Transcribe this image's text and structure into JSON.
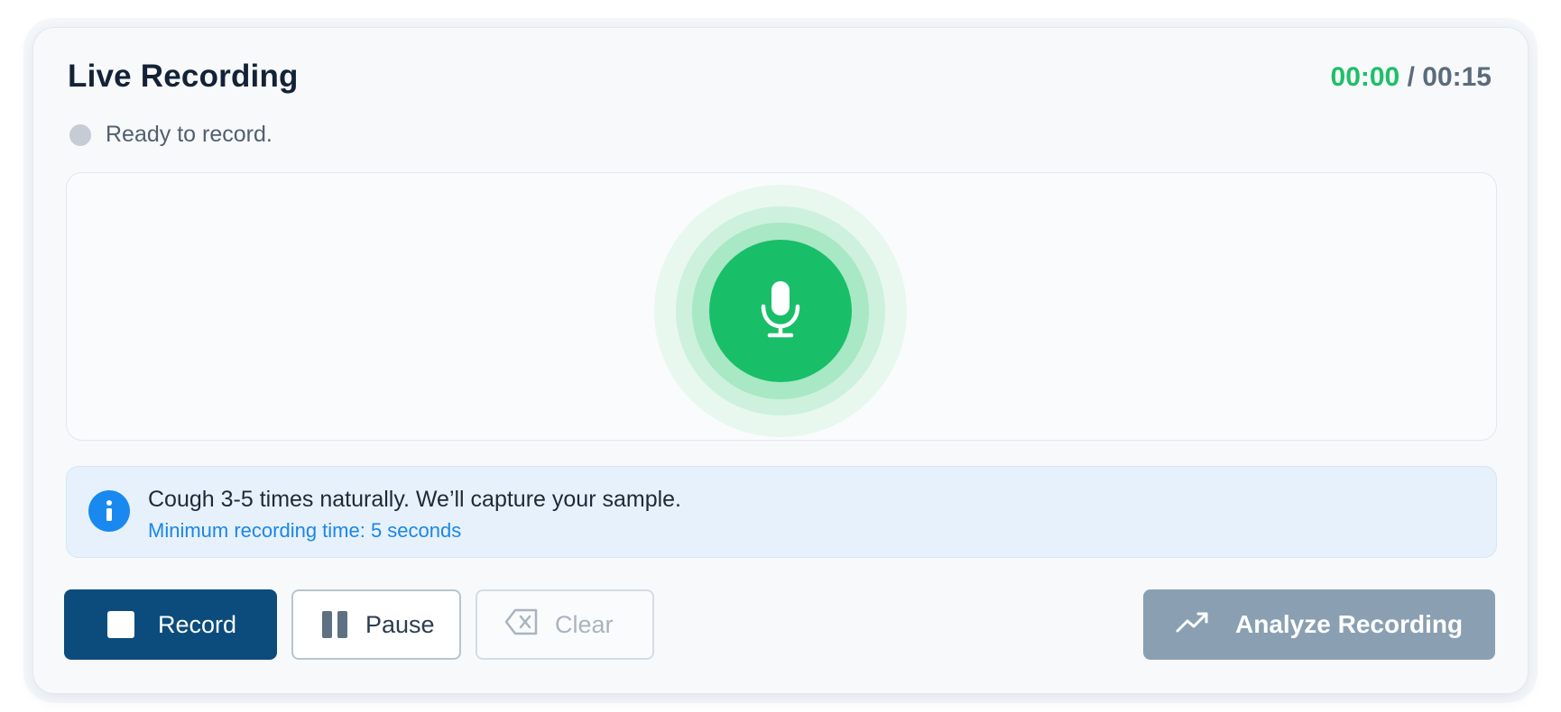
{
  "header": {
    "title": "Live Recording",
    "timer_elapsed": "00:00",
    "timer_separator": " / ",
    "timer_total": "00:15"
  },
  "status": {
    "text": "Ready to record."
  },
  "info": {
    "message": "Cough 3-5 times naturally. We’ll capture your sample.",
    "hint": "Minimum recording time: 5 seconds"
  },
  "controls": {
    "record_label": "Record",
    "pause_label": "Pause",
    "clear_label": "Clear",
    "analyze_label": "Analyze Recording"
  },
  "icons": {
    "mic": "microphone-icon",
    "info": "info-icon",
    "record": "stop-square-icon",
    "pause": "pause-icon",
    "clear": "backspace-icon",
    "analyze": "trending-up-icon"
  },
  "colors": {
    "accent_green": "#18bf68",
    "primary_blue": "#0b4c7c",
    "info_blue": "#1989f0",
    "disabled_gray": "#8aa0b2"
  }
}
